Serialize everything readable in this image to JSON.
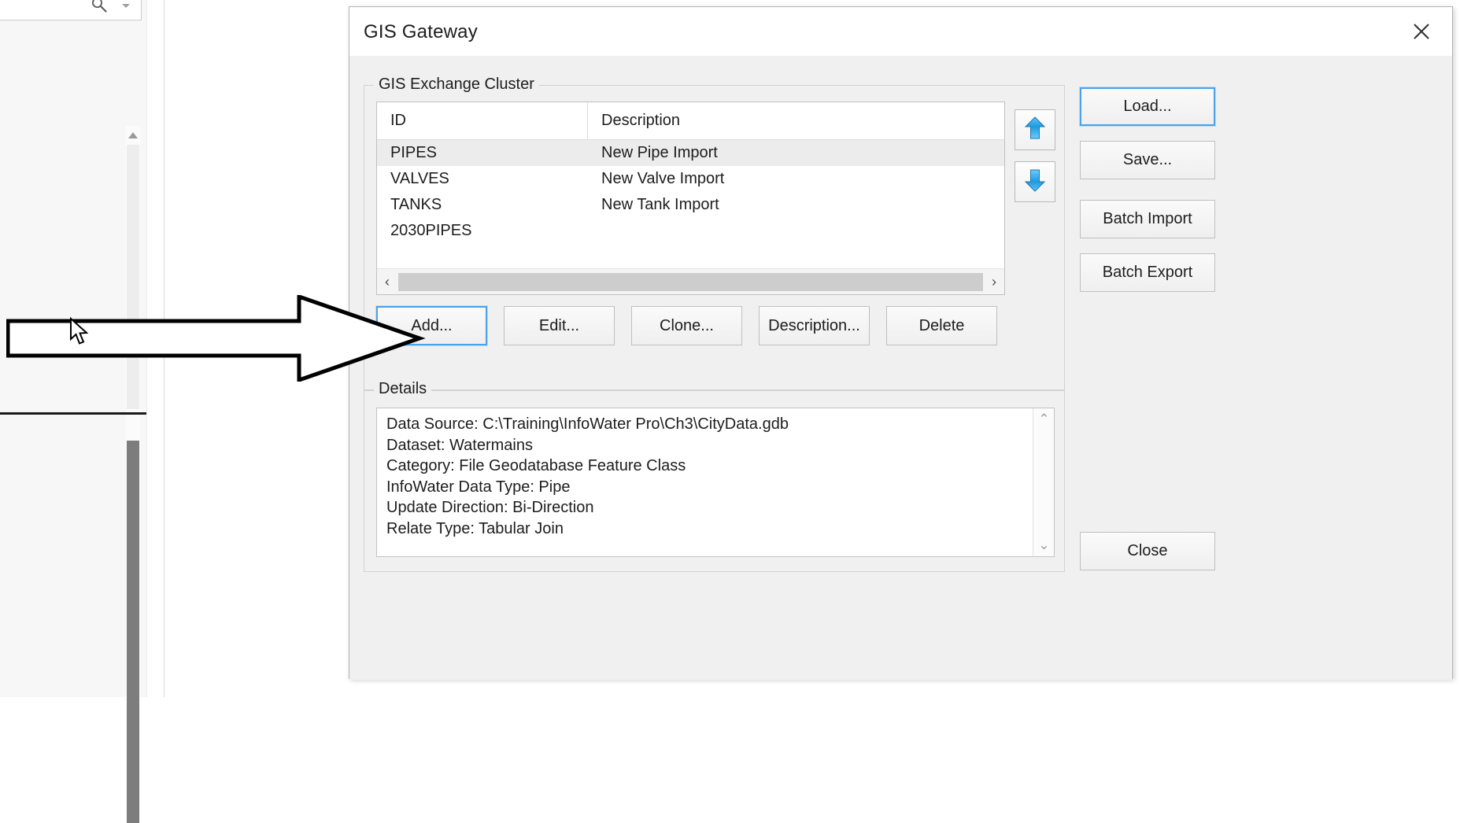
{
  "background": {
    "search": {
      "icon": "search-icon",
      "dropdown_icon": "chevron-down-icon",
      "value": "",
      "placeholder": ""
    }
  },
  "dialog": {
    "title": "GIS Gateway",
    "close_icon": "close-icon",
    "cluster": {
      "legend": "GIS Exchange Cluster",
      "columns": [
        "ID",
        "Description"
      ],
      "rows": [
        {
          "id": "PIPES",
          "description": "New Pipe Import",
          "selected": true
        },
        {
          "id": "VALVES",
          "description": "New Valve Import",
          "selected": false
        },
        {
          "id": "TANKS",
          "description": "New Tank Import",
          "selected": false
        },
        {
          "id": "2030PIPES",
          "description": "",
          "selected": false
        }
      ],
      "hscroll": {
        "left_icon": "‹",
        "right_icon": "›"
      },
      "reorder": {
        "up_icon": "arrow-up-icon",
        "down_icon": "arrow-down-icon",
        "accent": "#1f9ae0"
      },
      "actions": [
        {
          "label": "Add...",
          "name": "add-button",
          "focused": true
        },
        {
          "label": "Edit...",
          "name": "edit-button",
          "focused": false
        },
        {
          "label": "Clone...",
          "name": "clone-button",
          "focused": false
        },
        {
          "label": "Description...",
          "name": "description-button",
          "focused": false
        },
        {
          "label": "Delete",
          "name": "delete-button",
          "focused": false
        }
      ]
    },
    "details": {
      "legend": "Details",
      "lines": [
        "Data Source: C:\\Training\\InfoWater Pro\\Ch3\\CityData.gdb",
        "Dataset: Watermains",
        "Category: File Geodatabase Feature Class",
        "InfoWater Data Type: Pipe",
        "Update Direction: Bi-Direction",
        "Relate Type: Tabular Join"
      ],
      "scroll_up_icon": "⌃",
      "scroll_down_icon": "⌄"
    },
    "side_buttons": [
      {
        "label": "Load...",
        "name": "load-button",
        "focused": true
      },
      {
        "label": "Save...",
        "name": "save-button",
        "focused": false
      },
      {
        "label": "Batch Import",
        "name": "batch-import-button",
        "focused": false
      },
      {
        "label": "Batch Export",
        "name": "batch-export-button",
        "focused": false
      }
    ],
    "close_button_label": "Close"
  },
  "annotation": {
    "type": "arrow",
    "points_to": "add-button",
    "color": "#000000"
  },
  "colors": {
    "dialog_background": "#f0f0f0",
    "focus_blue": "#4aa3e8",
    "selection_gray": "#ececec",
    "arrow_blue": "#1f9ae0"
  }
}
